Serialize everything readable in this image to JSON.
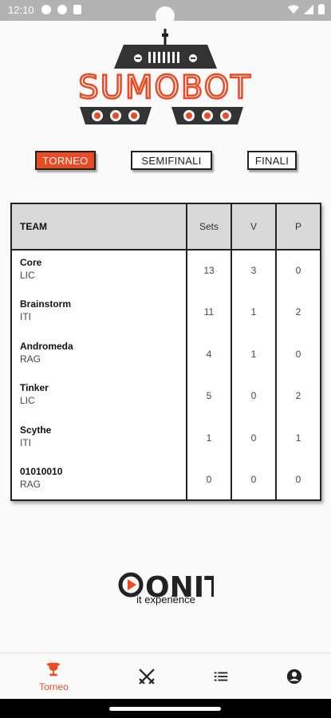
{
  "status_bar": {
    "time": "12:10"
  },
  "app": {
    "logo_text": "SUMOBOT"
  },
  "filters": {
    "torneo": "TORNEO",
    "semifinali": "SEMIFINALI",
    "finali": "FINALI"
  },
  "table": {
    "headers": {
      "team": "TEAM",
      "sets": "Sets",
      "v": "V",
      "p": "P"
    },
    "rows": [
      {
        "team": "Core",
        "group": "LIC",
        "sets": "13",
        "v": "3",
        "p": "0"
      },
      {
        "team": "Brainstorm",
        "group": "ITI",
        "sets": "11",
        "v": "1",
        "p": "2"
      },
      {
        "team": "Andromeda",
        "group": "RAG",
        "sets": "4",
        "v": "1",
        "p": "0"
      },
      {
        "team": "Tinker",
        "group": "LIC",
        "sets": "5",
        "v": "0",
        "p": "2"
      },
      {
        "team": "Scythe",
        "group": "ITI",
        "sets": "1",
        "v": "0",
        "p": "1"
      },
      {
        "team": "01010010",
        "group": "RAG",
        "sets": "0",
        "v": "0",
        "p": "0"
      }
    ]
  },
  "sponsor": {
    "name": "ONIT",
    "tagline": "it experience"
  },
  "nav": {
    "torneo_label": "Torneo",
    "icons": [
      "trophy-icon",
      "swords-icon",
      "list-icon",
      "account-icon"
    ]
  },
  "colors": {
    "accent": "#ec4a25",
    "header_bg": "#d9d9d9",
    "status_bar": "#b3b3b3"
  }
}
